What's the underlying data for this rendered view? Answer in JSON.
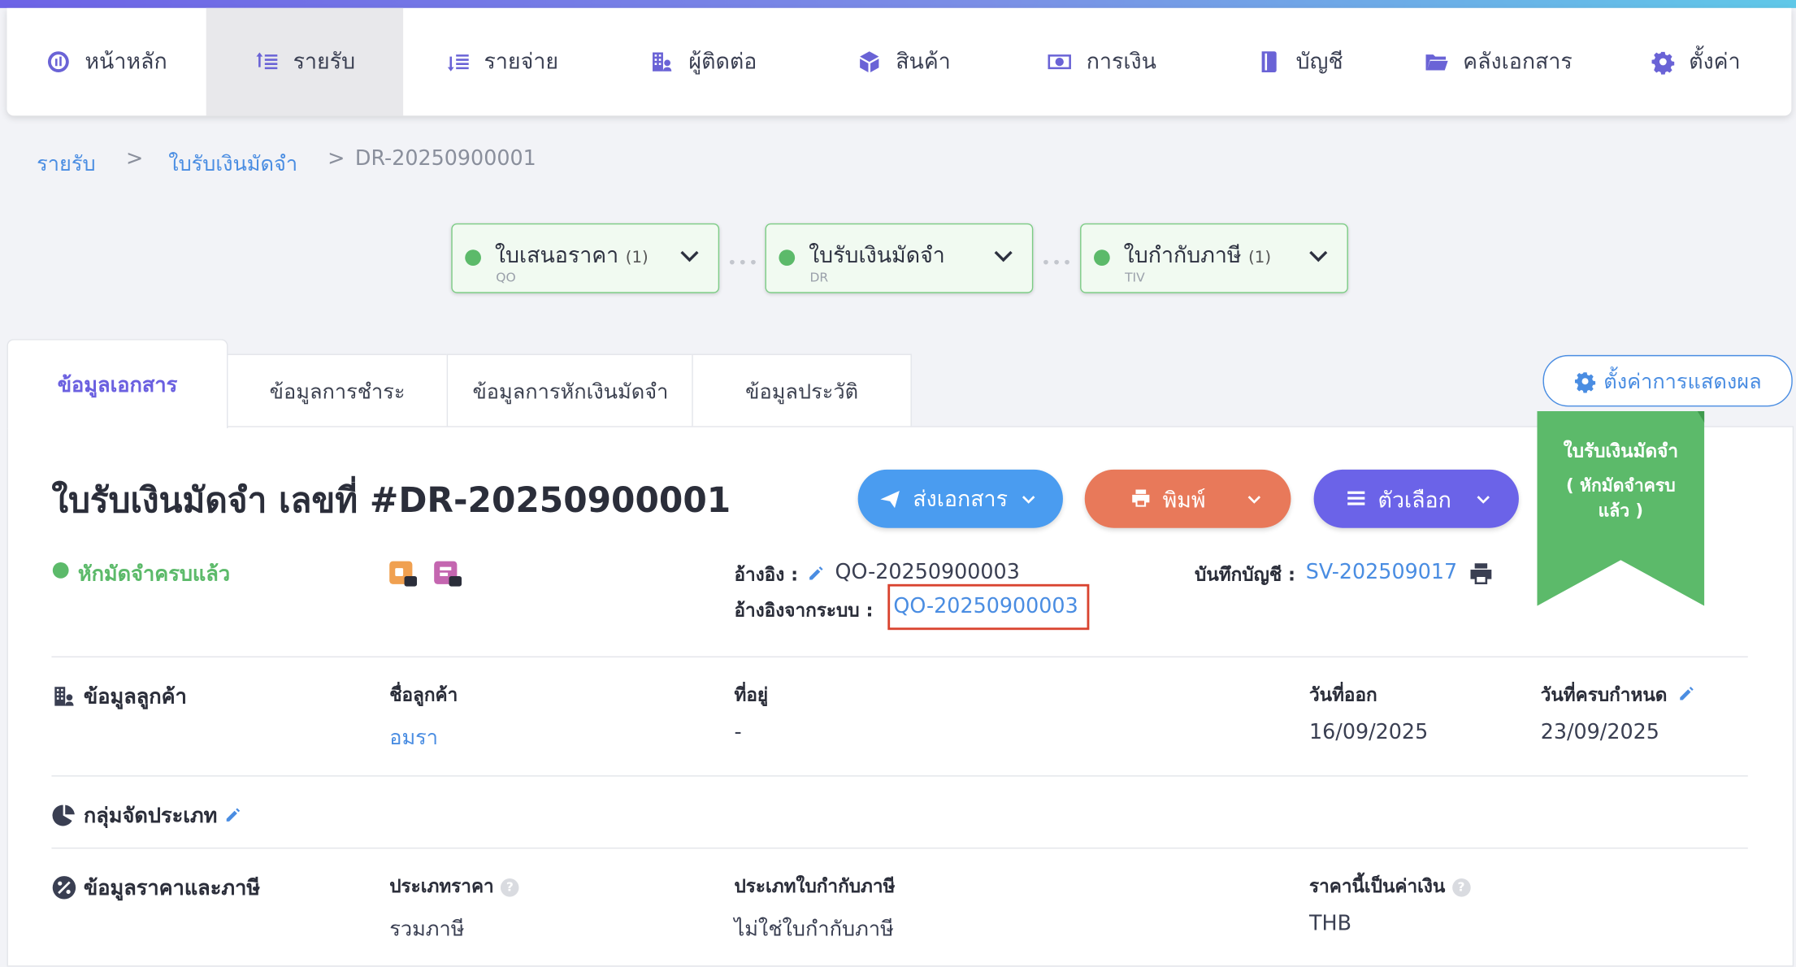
{
  "nav": [
    {
      "label": "หน้าหลัก",
      "icon": "dashboard-icon"
    },
    {
      "label": "รายรับ",
      "icon": "income-icon"
    },
    {
      "label": "รายจ่าย",
      "icon": "expense-icon"
    },
    {
      "label": "ผู้ติดต่อ",
      "icon": "contacts-icon"
    },
    {
      "label": "สินค้า",
      "icon": "box-icon"
    },
    {
      "label": "การเงิน",
      "icon": "money-icon"
    },
    {
      "label": "บัญชี",
      "icon": "ledger-icon"
    },
    {
      "label": "คลังเอกสาร",
      "icon": "folder-icon"
    },
    {
      "label": "ตั้งค่า",
      "icon": "gear-icon"
    }
  ],
  "breadcrumb": {
    "items": [
      "รายรับ",
      "ใบรับเงินมัดจำ",
      "DR-20250900001"
    ],
    "sep": ">"
  },
  "flow": [
    {
      "title": "ใบเสนอราคา",
      "count": "(1)",
      "code": "QO"
    },
    {
      "title": "ใบรับเงินมัดจำ",
      "count": "",
      "code": "DR"
    },
    {
      "title": "ใบกำกับภาษี",
      "count": "(1)",
      "code": "TIV"
    }
  ],
  "flow_sep": "•••",
  "tabs": [
    "ข้อมูลเอกสาร",
    "ข้อมูลการชำระ",
    "ข้อมูลการหักเงินมัดจำ",
    "ข้อมูลประวัติ"
  ],
  "display_settings": "ตั้งค่าการแสดงผล",
  "doc": {
    "title": "ใบรับเงินมัดจำ เลขที่ #DR-20250900001",
    "status": "หักมัดจำครบแล้ว",
    "ref_label": "อ้างอิง :",
    "ref_value": "QO-20250900003",
    "sys_ref_label": "อ้างอิงจากระบบ :",
    "sys_ref_value": "QO-20250900003",
    "journal_label": "บันทึกบัญชี :",
    "journal_value": "SV-202509017"
  },
  "buttons": {
    "send": "ส่งเอกสาร",
    "print": "พิมพ์",
    "options": "ตัวเลือก"
  },
  "ribbon": {
    "line1": "ใบรับเงินมัดจำ",
    "line2": "( หักมัดจำครบ",
    "line3": "แล้ว )"
  },
  "customer": {
    "section": "ข้อมูลลูกค้า",
    "name_label": "ชื่อลูกค้า",
    "name_value": "อมรา",
    "address_label": "ที่อยู่",
    "address_value": "-",
    "issue_label": "วันที่ออก",
    "issue_value": "16/09/2025",
    "due_label": "วันที่ครบกำหนด",
    "due_value": "23/09/2025"
  },
  "group": {
    "section": "กลุ่มจัดประเภท"
  },
  "pricing": {
    "section": "ข้อมูลราคาและภาษี",
    "price_type_label": "ประเภทราคา",
    "price_type_value": "รวมภาษี",
    "tax_type_label": "ประเภทใบกำกับภาษี",
    "tax_type_value": "ไม่ใช่ใบกำกับภาษี",
    "currency_label": "ราคานี้เป็นค่าเงิน",
    "currency_value": "THB"
  },
  "colors": {
    "accent": "#6b60e0",
    "send": "#4a9cf0",
    "print": "#e8795a",
    "options": "#6b63e8",
    "ribbon": "#5cba6a",
    "highlight": "#d9432f"
  }
}
